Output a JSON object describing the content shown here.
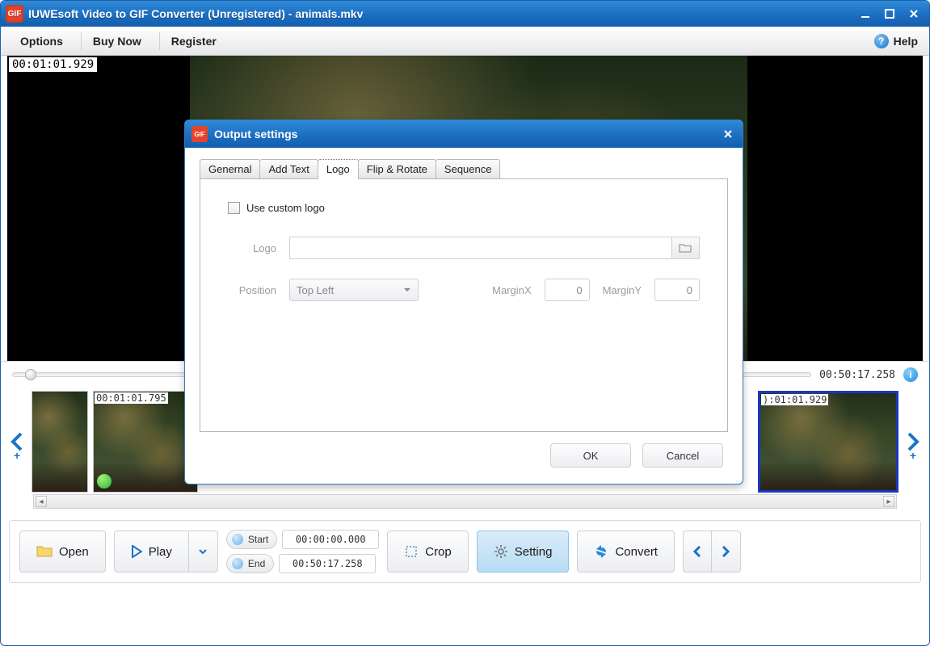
{
  "titlebar": {
    "title": "IUWEsoft Video to GIF Converter (Unregistered) - animals.mkv"
  },
  "menubar": {
    "options": "Options",
    "buynow": "Buy Now",
    "register": "Register",
    "help": "Help"
  },
  "preview": {
    "timecode": "00:01:01.929"
  },
  "timeline": {
    "total": "00:50:17.258"
  },
  "thumbs": {
    "t1": "",
    "t2": "00:01:01.795",
    "t3": "):01:01.929"
  },
  "bottombar": {
    "open": "Open",
    "play": "Play",
    "start_lbl": "Start",
    "start_val": "00:00:00.000",
    "end_lbl": "End",
    "end_val": "00:50:17.258",
    "crop": "Crop",
    "setting": "Setting",
    "convert": "Convert"
  },
  "dialog": {
    "title": "Output settings",
    "tabs": {
      "general": "Genernal",
      "addtext": "Add Text",
      "logo": "Logo",
      "flip": "Flip & Rotate",
      "sequence": "Sequence"
    },
    "chk": "Use custom logo",
    "logo_lbl": "Logo",
    "position_lbl": "Position",
    "position_val": "Top Left",
    "marginx_lbl": "MarginX",
    "marginx_val": "0",
    "marginy_lbl": "MarginY",
    "marginy_val": "0",
    "ok": "OK",
    "cancel": "Cancel"
  }
}
